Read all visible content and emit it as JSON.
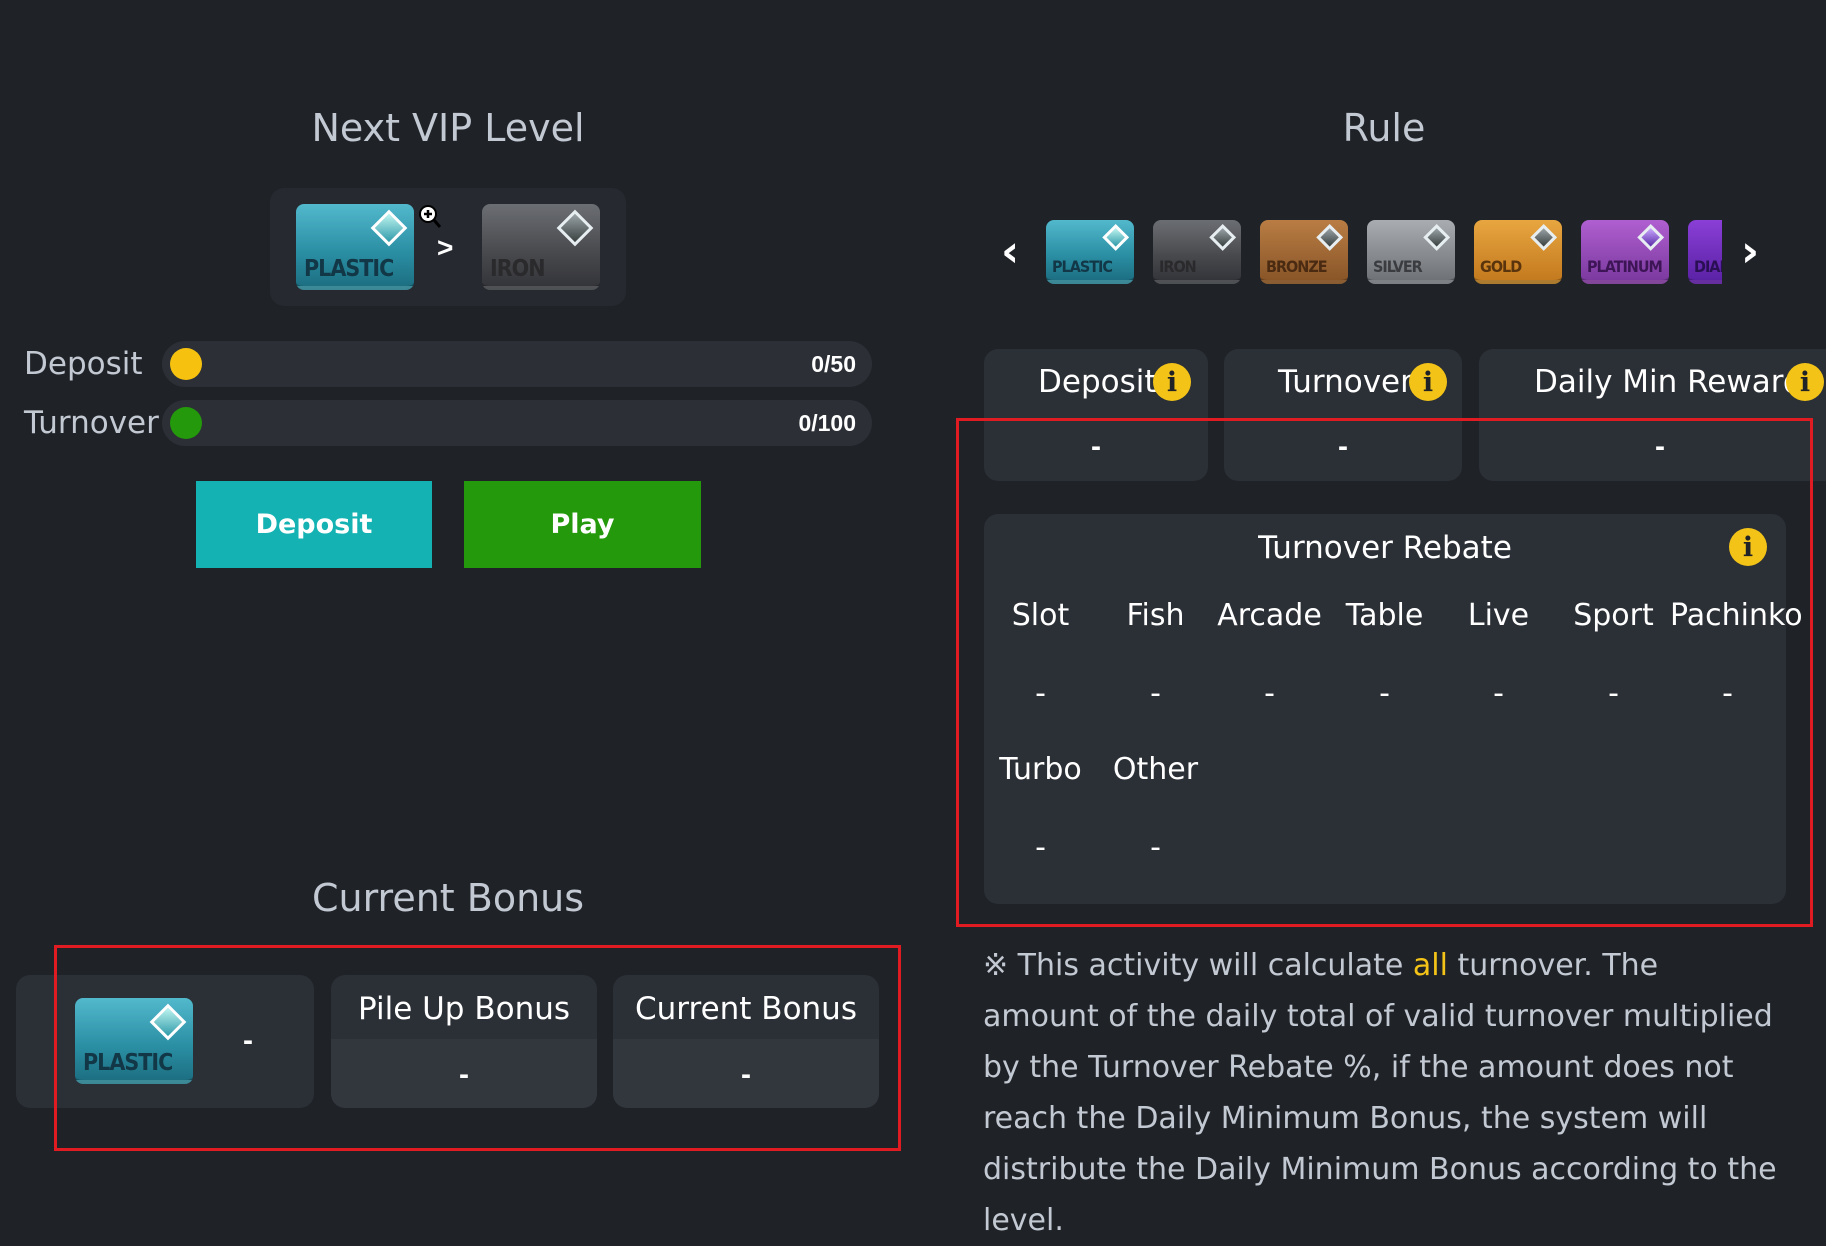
{
  "next_vip": {
    "title": "Next VIP Level",
    "current_level": "PLASTIC",
    "separator": ">",
    "next_level": "IRON"
  },
  "progress": {
    "deposit_label": "Deposit",
    "deposit_value": "0/50",
    "deposit_fraction": 0,
    "turnover_label": "Turnover",
    "turnover_value": "0/100",
    "turnover_fraction": 0
  },
  "actions": {
    "deposit_button": "Deposit",
    "play_button": "Play"
  },
  "current_bonus": {
    "title": "Current Bonus",
    "level_card": "PLASTIC",
    "level_value": "-",
    "pile_up_label": "Pile Up Bonus",
    "pile_up_value": "-",
    "current_label": "Current Bonus",
    "current_value": "-"
  },
  "rule": {
    "title": "Rule",
    "prev_icon": "chevron-left-icon",
    "next_icon": "chevron-right-icon",
    "levels": [
      "PLASTIC",
      "IRON",
      "BRONZE",
      "SILVER",
      "GOLD",
      "PLATINUM",
      "DIAMOND"
    ],
    "deposit_label": "Deposit",
    "deposit_value": "-",
    "turnover_label": "Turnover",
    "turnover_value": "-",
    "daily_min_label": "Daily Min Reward",
    "daily_min_value": "-",
    "rebate_title": "Turnover Rebate",
    "rebate_row1": [
      {
        "label": "Slot",
        "value": "-"
      },
      {
        "label": "Fish",
        "value": "-"
      },
      {
        "label": "Arcade",
        "value": "-"
      },
      {
        "label": "Table",
        "value": "-"
      },
      {
        "label": "Live",
        "value": "-"
      },
      {
        "label": "Sport",
        "value": "-"
      },
      {
        "label": "Pachinko",
        "value": "-"
      }
    ],
    "rebate_row2": [
      {
        "label": "Turbo",
        "value": "-"
      },
      {
        "label": "Other",
        "value": "-"
      }
    ]
  },
  "note": {
    "prefix": "※ This activity will calculate ",
    "highlight": "all",
    "suffix": " turnover. The amount of the daily total of valid turnover multiplied by the Turnover Rebate %, if the amount does not reach the Daily Minimum Bonus, the system will distribute the Daily Minimum Bonus according to the level."
  },
  "colors": {
    "background": "#1f2227",
    "panel": "#2b2f36",
    "deposit_button": "#14b2b2",
    "play_button": "#23990b",
    "deposit_dot": "#f7c20f",
    "turnover_dot": "#23990b",
    "info_badge": "#f3c318",
    "highlight_box": "#e11b22"
  }
}
